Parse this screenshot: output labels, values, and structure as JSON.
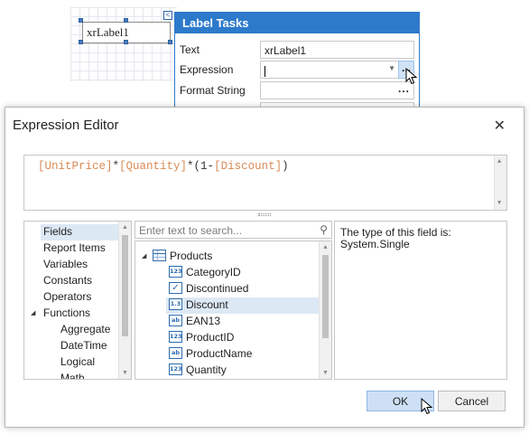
{
  "designer": {
    "label_text": "xrLabel1",
    "smart_tag_glyph": "<"
  },
  "label_tasks": {
    "title": "Label Tasks",
    "rows": [
      {
        "label": "Text",
        "value": "xrLabel1"
      },
      {
        "label": "Expression",
        "value": ""
      },
      {
        "label": "Format String",
        "value": ""
      }
    ],
    "ellipsis": "..."
  },
  "dialog": {
    "title": "Expression Editor",
    "close_glyph": "✕",
    "expression": [
      {
        "text": "[UnitPrice]",
        "kind": "field"
      },
      {
        "text": "*",
        "kind": "op"
      },
      {
        "text": "[Quantity]",
        "kind": "field"
      },
      {
        "text": "*(1-",
        "kind": "op"
      },
      {
        "text": "[Discount]",
        "kind": "field"
      },
      {
        "text": ")",
        "kind": "op"
      }
    ],
    "categories": [
      {
        "label": "Fields",
        "selected": true
      },
      {
        "label": "Report Items"
      },
      {
        "label": "Variables"
      },
      {
        "label": "Constants"
      },
      {
        "label": "Operators"
      },
      {
        "label": "Functions",
        "expanded": true
      },
      {
        "label": "Aggregate",
        "sub": true
      },
      {
        "label": "DateTime",
        "sub": true
      },
      {
        "label": "Logical",
        "sub": true
      },
      {
        "label": "Math",
        "sub": true
      }
    ],
    "search_placeholder": "Enter text to search...",
    "tree": {
      "root": "Products",
      "items": [
        {
          "label": "CategoryID",
          "icon": "123"
        },
        {
          "label": "Discontinued",
          "icon": "check"
        },
        {
          "label": "Discount",
          "icon": "1.3",
          "selected": true
        },
        {
          "label": "EAN13",
          "icon": "ab"
        },
        {
          "label": "ProductID",
          "icon": "123"
        },
        {
          "label": "ProductName",
          "icon": "ab"
        },
        {
          "label": "Quantity",
          "icon": "123"
        }
      ]
    },
    "description_line1": "The type of this field is:",
    "description_line2": "System.Single",
    "ok_label": "OK",
    "cancel_label": "Cancel"
  }
}
